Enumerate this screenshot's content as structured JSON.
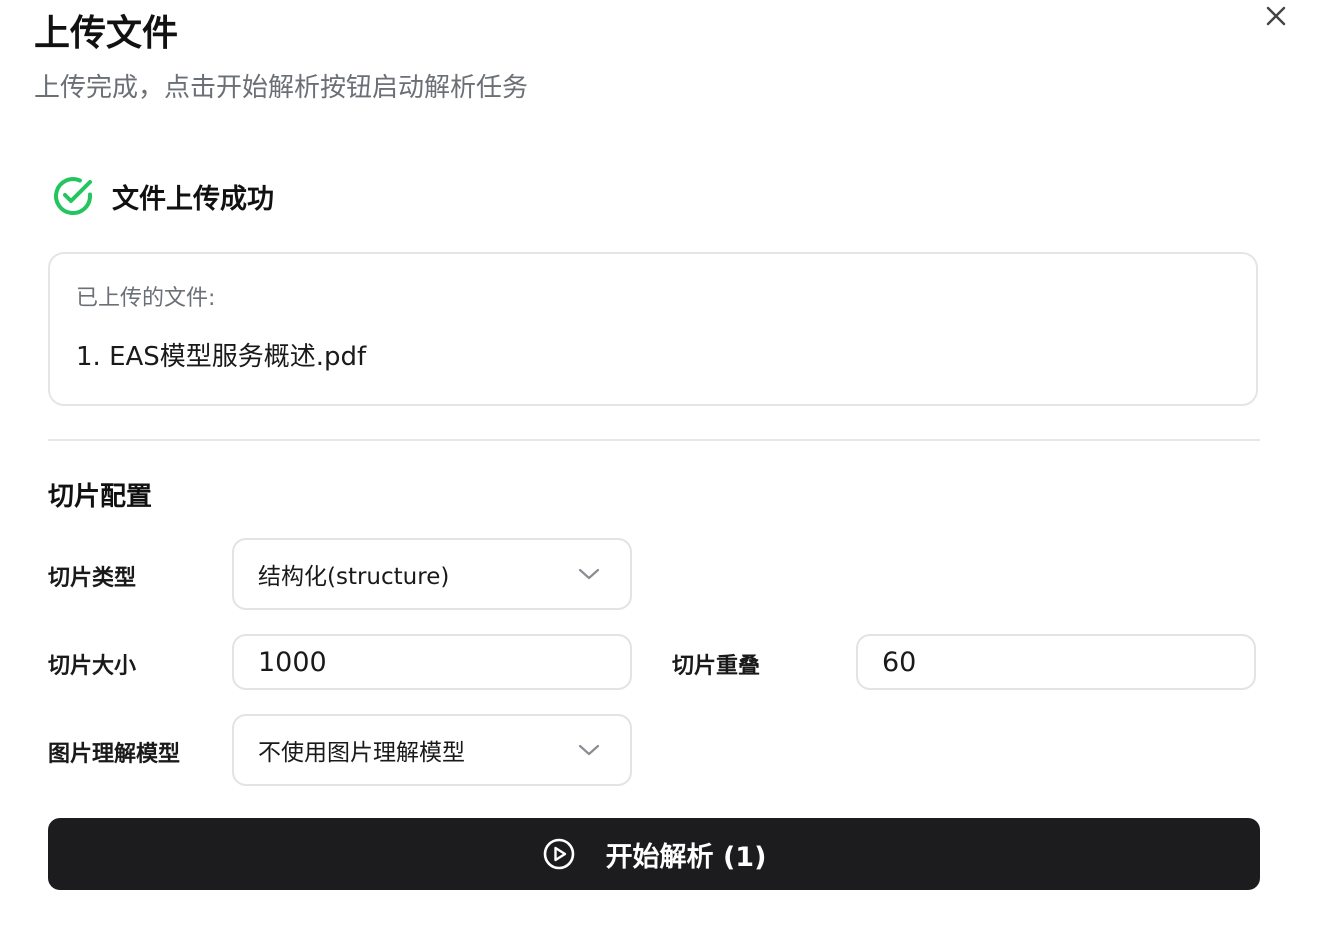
{
  "dialog": {
    "title": "上传文件",
    "subtitle": "上传完成，点击开始解析按钮启动解析任务",
    "close_icon": "close-icon"
  },
  "success": {
    "icon": "check-circle-icon",
    "text": "文件上传成功",
    "color": "#22c55e"
  },
  "uploaded_files": {
    "label": "已上传的文件:",
    "items": [
      "1. EAS模型服务概述.pdf"
    ]
  },
  "chunk_config": {
    "section_title": "切片配置",
    "chunk_type": {
      "label": "切片类型",
      "selected": "结构化(structure)"
    },
    "chunk_size": {
      "label": "切片大小",
      "value": "1000"
    },
    "chunk_overlap": {
      "label": "切片重叠",
      "value": "60"
    },
    "image_model": {
      "label": "图片理解模型",
      "selected": "不使用图片理解模型"
    }
  },
  "start_button": {
    "label": "开始解析 (1)",
    "icon": "play-circle-icon",
    "background": "#1c1c1e"
  }
}
